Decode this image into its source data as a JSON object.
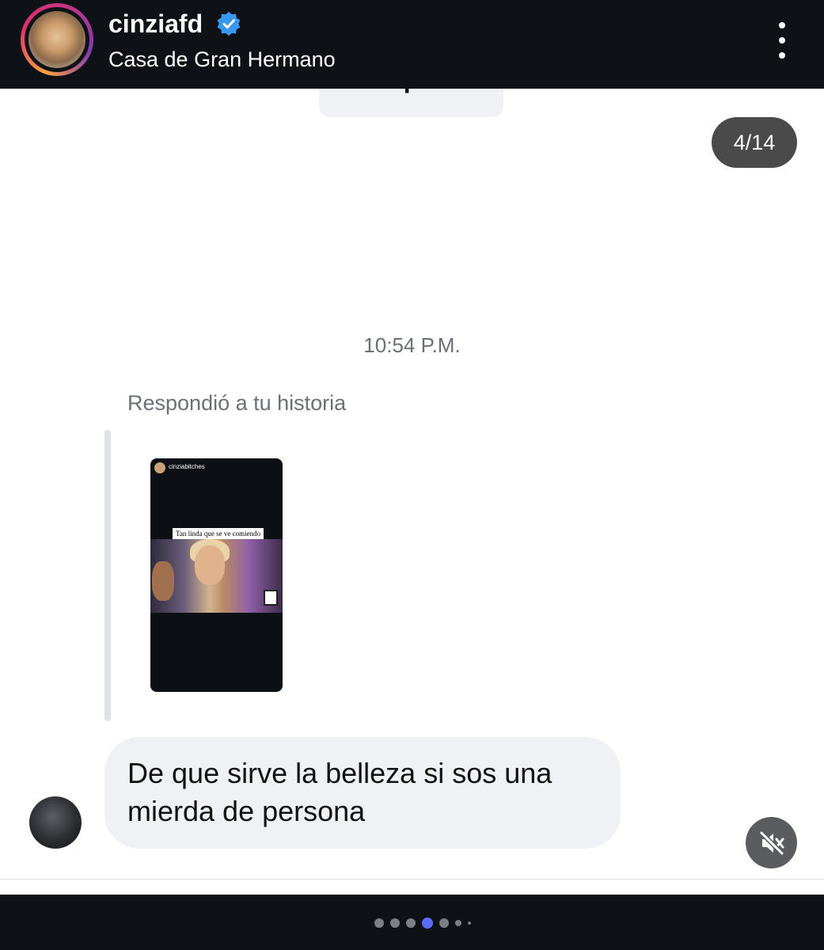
{
  "header": {
    "username": "cinziafd",
    "subtitle": "Casa de Gran Hermano",
    "verified": true,
    "menu_icon": "more-vertical-icon"
  },
  "conversation": {
    "view_profile_label": "Ver perfil",
    "counter": "4/14",
    "timestamp": "10:54 P.M.",
    "replied_label": "Respondió a tu historia",
    "story": {
      "username": "cinziabitches",
      "caption": "Tan linda que se ve comiendo"
    },
    "message_text": "De que sirve la belleza si sos una mierda de persona"
  },
  "controls": {
    "mute_icon": "volume-muted-icon"
  },
  "pagination": {
    "total": 7,
    "active_index": 3,
    "accent_color": "#5b6cff"
  },
  "colors": {
    "bar_background": "#0e1217",
    "bubble_background": "#eff1f4",
    "verified_blue": "#3897f0"
  }
}
